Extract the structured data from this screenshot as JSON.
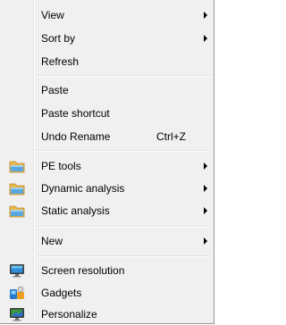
{
  "menu": {
    "items": [
      {
        "label": "View",
        "submenu": true
      },
      {
        "label": "Sort by",
        "submenu": true
      },
      {
        "label": "Refresh"
      },
      {
        "label": "Paste"
      },
      {
        "label": "Paste shortcut"
      },
      {
        "label": "Undo Rename",
        "shortcut": "Ctrl+Z"
      },
      {
        "label": "PE tools",
        "submenu": true,
        "icon": "folder-icon"
      },
      {
        "label": "Dynamic analysis",
        "submenu": true,
        "icon": "folder-icon"
      },
      {
        "label": "Static analysis",
        "submenu": true,
        "icon": "folder-icon"
      },
      {
        "label": "New",
        "submenu": true
      },
      {
        "label": "Screen resolution",
        "icon": "monitor-icon"
      },
      {
        "label": "Gadgets",
        "icon": "gadgets-icon"
      },
      {
        "label": "Personalize",
        "icon": "personalize-icon"
      }
    ]
  }
}
